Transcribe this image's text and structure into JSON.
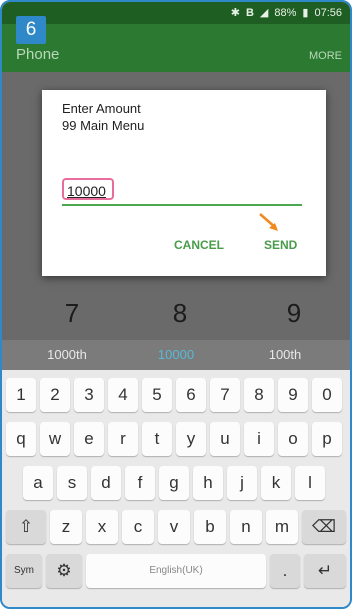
{
  "step_number": "6",
  "status_bar": {
    "battery": "88%",
    "time": "07:56"
  },
  "app_bar": {
    "title": "Phone",
    "more": "MORE"
  },
  "dialog": {
    "title_line1": "Enter Amount",
    "title_line2": "99 Main Menu",
    "input_value": "10000",
    "cancel_label": "CANCEL",
    "send_label": "SEND"
  },
  "dialer_keys": [
    "7",
    "8",
    "9"
  ],
  "suggestions": {
    "left": "1000th",
    "middle": "10000",
    "right": "100th",
    "middle_color": "#5bb8d8"
  },
  "keyboard": {
    "row_numbers": [
      "1",
      "2",
      "3",
      "4",
      "5",
      "6",
      "7",
      "8",
      "9",
      "0"
    ],
    "row_qwerty": [
      "q",
      "w",
      "e",
      "r",
      "t",
      "y",
      "u",
      "i",
      "o",
      "p"
    ],
    "row_asdf": [
      "a",
      "s",
      "d",
      "f",
      "g",
      "h",
      "j",
      "k",
      "l"
    ],
    "row_zxcv": [
      "z",
      "x",
      "c",
      "v",
      "b",
      "n",
      "m"
    ],
    "sym_label": "Sym",
    "space_label": "English(UK)",
    "punct_label": "."
  },
  "colors": {
    "status_bar": "#1e5e23",
    "app_bar": "#2c7a31",
    "accent": "#4a9b4a",
    "frame": "#2f88c7",
    "input_highlight": "#e86c9c",
    "arrow": "#f08a1c"
  }
}
